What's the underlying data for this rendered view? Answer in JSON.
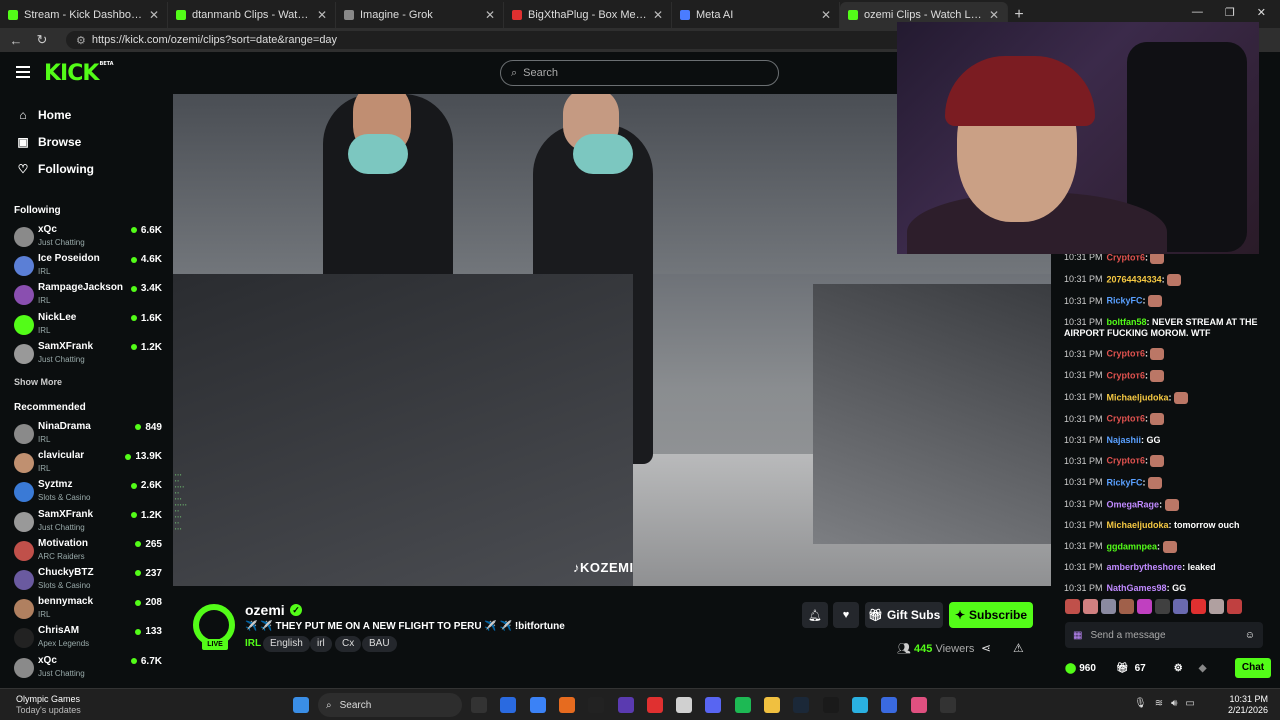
{
  "browser": {
    "tabs": [
      {
        "title": "Stream - Kick Dashboard",
        "color": "#53fc18"
      },
      {
        "title": "dtanmanb Clips - Watch Live on Ki",
        "color": "#53fc18"
      },
      {
        "title": "Imagine - Grok",
        "color": "#888888"
      },
      {
        "title": "BigXthaPlug - Box Me Up feat. Jel",
        "color": "#e03030"
      },
      {
        "title": "Meta AI",
        "color": "#4a7cff"
      },
      {
        "title": "ozemi Clips - Watch Live on Ki",
        "color": "#53fc18"
      }
    ],
    "url": "https://kick.com/ozemi/clips?sort=date&range=day"
  },
  "kick": {
    "logo": "KICK",
    "beta": "BETA",
    "search_placeholder": "Search",
    "accent": "#53fc18"
  },
  "sidebar": {
    "nav": [
      {
        "label": "Home",
        "icon": "home-icon"
      },
      {
        "label": "Browse",
        "icon": "browse-icon"
      },
      {
        "label": "Following",
        "icon": "heart-icon"
      }
    ],
    "following_title": "Following",
    "following": [
      {
        "name": "xQc",
        "category": "Just Chatting",
        "viewers": "6.6K",
        "color": "#8a8a8a"
      },
      {
        "name": "Ice Poseidon",
        "category": "IRL",
        "viewers": "4.6K",
        "color": "#5b7fd6"
      },
      {
        "name": "RampageJackson",
        "category": "IRL",
        "viewers": "3.4K",
        "color": "#8a4fb0"
      },
      {
        "name": "NickLee",
        "category": "IRL",
        "viewers": "1.6K",
        "color": "#53fc18"
      },
      {
        "name": "SamXFrank",
        "category": "Just Chatting",
        "viewers": "1.2K",
        "color": "#999999"
      }
    ],
    "show_more": "Show More",
    "recommended_title": "Recommended",
    "recommended": [
      {
        "name": "NinaDrama",
        "category": "IRL",
        "viewers": "849",
        "color": "#8a8a8a"
      },
      {
        "name": "clavicular",
        "category": "IRL",
        "viewers": "13.9K",
        "color": "#c09070"
      },
      {
        "name": "Syztmz",
        "category": "Slots & Casino",
        "viewers": "2.6K",
        "color": "#3a7ad6"
      },
      {
        "name": "SamXFrank",
        "category": "Just Chatting",
        "viewers": "1.2K",
        "color": "#999999"
      },
      {
        "name": "Motivation",
        "category": "ARC Raiders",
        "viewers": "265",
        "color": "#c0504a"
      },
      {
        "name": "ChuckyBTZ",
        "category": "Slots & Casino",
        "viewers": "237",
        "color": "#6a5aa0"
      },
      {
        "name": "bennymack",
        "category": "IRL",
        "viewers": "208",
        "color": "#b08060"
      },
      {
        "name": "ChrisAM",
        "category": "Apex Legends",
        "viewers": "133",
        "color": "#222222"
      },
      {
        "name": "xQc",
        "category": "Just Chatting",
        "viewers": "6.7K",
        "color": "#8a8a8a"
      }
    ]
  },
  "video": {
    "watermark": "KOZEMI"
  },
  "stream": {
    "name": "ozemi",
    "live": "LIVE",
    "title": "✈️ ✈️ THEY PUT ME ON A NEW FLIGHT TO PERU ✈️ ✈️ !bitfortune",
    "category": "IRL",
    "tags": [
      "English",
      "irl",
      "Cx",
      "BAU"
    ],
    "gift_label": "Gift Subs",
    "subscribe_label": "Subscribe",
    "viewers": "445",
    "viewers_label": "Viewers"
  },
  "chat": {
    "messages": [
      {
        "time": "10:31 PM",
        "user": "Cryptoᴛ6",
        "text": "",
        "color": "#e0524f",
        "emote": true
      },
      {
        "time": "10:31 PM",
        "user": "20764434334",
        "text": "",
        "color": "#f5c842",
        "emote": true
      },
      {
        "time": "10:31 PM",
        "user": "RickyFC",
        "text": "",
        "color": "#5aa0ff",
        "emote": true
      },
      {
        "time": "10:31 PM",
        "user": "boltfan58",
        "text": "NEVER STREAM AT THE AIRPORT FUCKING MOROM. WTF",
        "color": "#53fc18",
        "emote": false
      },
      {
        "time": "10:31 PM",
        "user": "Cryptoᴛ6",
        "text": "",
        "color": "#e0524f",
        "emote": true
      },
      {
        "time": "10:31 PM",
        "user": "Cryptoᴛ6",
        "text": "",
        "color": "#e0524f",
        "emote": true
      },
      {
        "time": "10:31 PM",
        "user": "Michaeljudoka",
        "text": "",
        "color": "#f5c842",
        "emote": true
      },
      {
        "time": "10:31 PM",
        "user": "Cryptoᴛ6",
        "text": "",
        "color": "#e0524f",
        "emote": true
      },
      {
        "time": "10:31 PM",
        "user": "Najashii",
        "text": "GG",
        "color": "#5aa0ff",
        "emote": false
      },
      {
        "time": "10:31 PM",
        "user": "Cryptoᴛ6",
        "text": "",
        "color": "#e0524f",
        "emote": true
      },
      {
        "time": "10:31 PM",
        "user": "RickyFC",
        "text": "",
        "color": "#5aa0ff",
        "emote": true
      },
      {
        "time": "10:31 PM",
        "user": "OmegaRage",
        "text": "",
        "color": "#c08aff",
        "emote": true
      },
      {
        "time": "10:31 PM",
        "user": "Michaeljudoka",
        "text": "tomorrow ouch",
        "color": "#f5c842",
        "emote": false
      },
      {
        "time": "10:31 PM",
        "user": "ggdamnpea",
        "text": "",
        "color": "#53fc18",
        "emote": true
      },
      {
        "time": "10:31 PM",
        "user": "amberbytheshore",
        "text": "leaked",
        "color": "#c08aff",
        "emote": false
      },
      {
        "time": "10:31 PM",
        "user": "NathGames98",
        "text": "GG",
        "color": "#c08aff",
        "emote": false
      }
    ],
    "input_placeholder": "Send a message",
    "points": "960",
    "gifts": "67",
    "chat_button": "Chat"
  },
  "taskbar": {
    "weather_title": "Olympic Games",
    "weather_sub": "Today's updates",
    "search_label": "Search",
    "time": "10:31 PM",
    "date": "2/21/2026"
  }
}
